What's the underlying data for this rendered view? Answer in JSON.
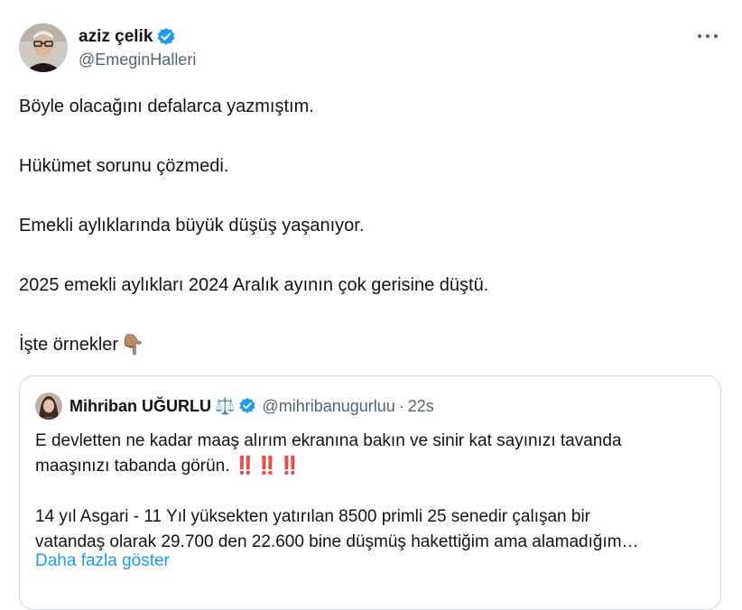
{
  "tweet": {
    "author": {
      "display_name": "aziz çelik",
      "handle": "@EmeginHalleri",
      "verified_color": "#1d9bf0"
    },
    "paragraphs": [
      "Böyle olacağını defalarca yazmıştım.",
      "Hükümet sorunu çözmedi.",
      "Emekli aylıklarında büyük düşüş yaşanıyor.",
      "2025 emekli aylıkları 2024 Aralık ayının çok gerisine düştü.",
      "İşte örnekler"
    ],
    "emoji": "👇🏽",
    "more_icon": "more-horizontal-icon"
  },
  "quote": {
    "author": {
      "display_name": "Mihriban UĞURLU",
      "badge_emoji": "⚖️",
      "handle": "@mihribanugurluu",
      "separator": "·",
      "time": "22s"
    },
    "lines": [
      "E devletten ne kadar maaş alırım ekranına bakın ve sinir kat sayınızı tavanda",
      "maaşınızı tabanda görün.",
      "14 yıl Asgari - 11 Yıl yüksekten yatırılan 8500 primli 25 senedir çalışan bir",
      "vatandaş olarak 29.700 den 22.600 bine düşmüş hakettiğim ama alamadığım…"
    ],
    "exclamations": "‼️‼️‼️",
    "show_more": "Daha fazla göster",
    "link_color": "#1d9bf0"
  }
}
